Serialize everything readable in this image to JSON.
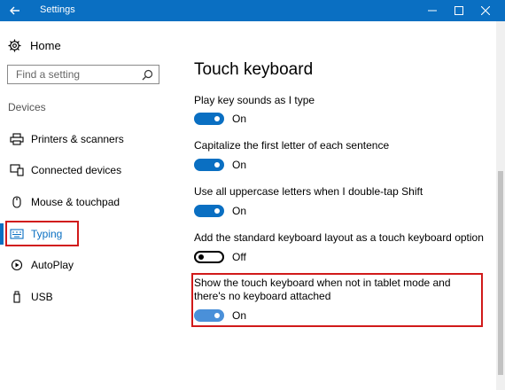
{
  "window": {
    "title": "Settings",
    "accent": "#0a6fc2"
  },
  "sidebar": {
    "home_label": "Home",
    "search_placeholder": "Find a setting",
    "section_label": "Devices",
    "items": [
      {
        "label": "Printers & scanners",
        "icon": "printer-icon"
      },
      {
        "label": "Connected devices",
        "icon": "connected-devices-icon"
      },
      {
        "label": "Mouse & touchpad",
        "icon": "mouse-icon"
      },
      {
        "label": "Typing",
        "icon": "keyboard-icon",
        "selected": true
      },
      {
        "label": "AutoPlay",
        "icon": "autoplay-icon"
      },
      {
        "label": "USB",
        "icon": "usb-icon"
      }
    ]
  },
  "main": {
    "title": "Touch keyboard",
    "settings": [
      {
        "label": "Play key sounds as I type",
        "state": "On"
      },
      {
        "label": "Capitalize the first letter of each sentence",
        "state": "On"
      },
      {
        "label": "Use all uppercase letters when I double-tap Shift",
        "state": "On"
      },
      {
        "label": "Add the standard keyboard layout as a touch keyboard option",
        "state": "Off"
      },
      {
        "label": "Show the touch keyboard when not in tablet mode and there's no keyboard attached",
        "state": "On"
      }
    ]
  },
  "highlight_color": "#d11a1a"
}
